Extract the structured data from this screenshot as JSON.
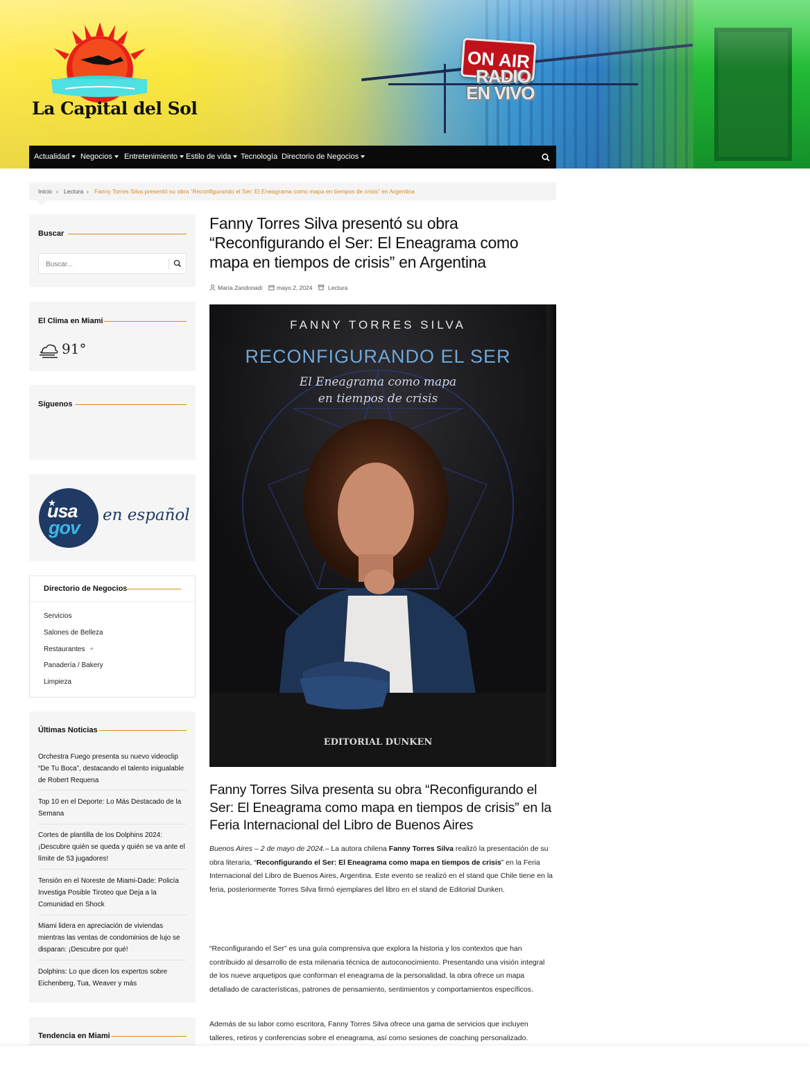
{
  "header": {
    "site_title": "La Capital del Sol",
    "onair_label": "ON AIR",
    "radio_label": "RADIO",
    "envivo_label": "EN VIVO"
  },
  "nav": {
    "items": [
      {
        "label": "Actualidad",
        "dropdown": true
      },
      {
        "label": "Negocios",
        "dropdown": true
      },
      {
        "label": "Entretenimiento",
        "dropdown": true
      },
      {
        "label": "Estilo de vida",
        "dropdown": true
      },
      {
        "label": "Tecnología",
        "dropdown": false
      },
      {
        "label": "Directorio de Negocios",
        "dropdown": true
      }
    ],
    "search_icon": "search-icon"
  },
  "breadcrumb": {
    "home": "Inicio",
    "category": "Lectura",
    "current": "Fanny Torres Silva presentó su obra “Reconfigurando el Ser: El Eneagrama como mapa en tiempos de crisis” en Argentina"
  },
  "sidebar": {
    "search": {
      "title": "Buscar",
      "placeholder": "Buscar..."
    },
    "weather": {
      "title": "El Clima en Miami",
      "temp": "91°",
      "icon": "cloud-fog-icon"
    },
    "follow": {
      "title": "Síguenos"
    },
    "usagov": {
      "usa": "usa",
      "gov": "gov",
      "tagline": "en español"
    },
    "directory": {
      "title": "Directorio de Negocios",
      "links": [
        "Servicios",
        "Salones de Belleza",
        "Restaurantes",
        "Panadería / Bakery",
        "Limpieza"
      ],
      "expand_symbol": "+"
    },
    "latest": {
      "title": "Últimas Noticias",
      "items": [
        "Orchestra Fuego presenta su nuevo videoclip “De Tu Boca”, destacando el talento inigualable de Robert Requena",
        "Top 10 en el Deporte: Lo Más Destacado de la Semana",
        "Cortes de plantilla de los Dolphins 2024: ¡Descubre quién se queda y quién se va ante el límite de 53 jugadores!",
        "Tensión en el Noreste de Miami-Dade: Policía Investiga Posible Tiroteo que Deja a la Comunidad en Shock",
        "Miami lidera en apreciación de viviendas mientras las ventas de condominios de lujo se disparan: ¡Descubre por qué!",
        "Dolphins: Lo que dicen los expertos sobre Eichenberg, Tua, Weaver y más"
      ]
    },
    "trending": {
      "title": "Tendencia en Miami"
    }
  },
  "article": {
    "title": "Fanny Torres Silva presentó su obra “Reconfigurando el Ser: El Eneagrama como mapa en tiempos de crisis” en Argentina",
    "author": "María Zandonadi",
    "date": "mayo 2, 2024",
    "category": "Lectura",
    "cover": {
      "author": "FANNY TORRES SILVA",
      "title": "RECONFIGURANDO EL SER",
      "subtitle_line1": "El Eneagrama como mapa",
      "subtitle_line2": "en tiempos de crisis",
      "publisher": "EDITORIAL DUNKEN"
    },
    "heading": "Fanny Torres Silva presenta su obra “Reconfigurando el Ser: El Eneagrama como mapa en tiempos de crisis” en la Feria Internacional del Libro de Buenos Aires",
    "p1": {
      "dateline": "Buenos Aires – 2 de mayo de 2024.",
      "a": "– La autora chilena ",
      "name": "Fanny Torres Silva",
      "b": " realizó la presentación de su obra literaria, “",
      "book": "Reconfigurando el Ser: El Eneagrama como mapa en tiempos de crisis",
      "c": "” en la Feria Internacional del Libro de Buenos Aires, Argentina. Este evento se realizó en el stand que Chile tiene en la feria, posteriormente Torres Silva firmó ejemplares del libro en el stand de Editorial Dunken."
    },
    "p2": "“Reconfigurando el Ser” es una guía comprensiva que explora la historia y los contextos que han contribuido al desarrollo de esta milenaria técnica de autoconocimiento. Presentando una visión integral de los nueve arquetipos que conforman el eneagrama de la personalidad, la obra ofrece un mapa detallado de características, patrones de pensamiento, sentimientos y comportamientos específicos.",
    "p3": "Además de su labor como escritora, Fanny Torres Silva ofrece una gama de servicios que incluyen talleres, retiros y conferencias sobre el eneagrama, así como sesiones de coaching personalizado."
  },
  "colors": {
    "accent": "#d98a1e",
    "nav_bg": "#0a0a0a",
    "widget_bg": "#f5f5f5",
    "cover_title": "#6fa8d8"
  }
}
